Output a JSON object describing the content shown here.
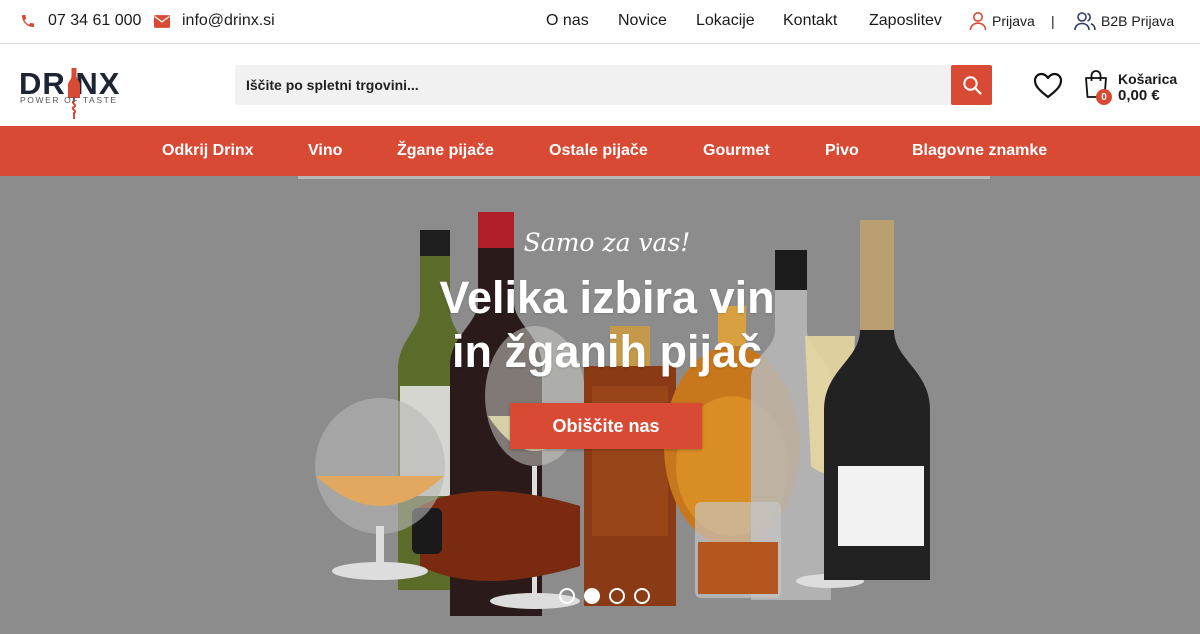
{
  "topbar": {
    "phone": "07 34 61 000",
    "email": "info@drinx.si",
    "nav": [
      "O nas",
      "Novice",
      "Lokacije",
      "Kontakt",
      "Zaposlitev"
    ],
    "login": "Prijava",
    "separator": "|",
    "b2b_login": "B2B Prijava"
  },
  "logo": {
    "text": "DR NX",
    "tagline": "POWER OF TASTE"
  },
  "search": {
    "placeholder": "Iščite po spletni trgovini..."
  },
  "cart": {
    "label": "Košarica",
    "total": "0,00 €",
    "count": "0"
  },
  "main_nav": [
    "Odkrij Drinx",
    "Vino",
    "Žgane pijače",
    "Ostale pijače",
    "Gourmet",
    "Pivo",
    "Blagovne znamke"
  ],
  "hero": {
    "tagline": "Samo za vas!",
    "headline_1": "Velika izbira vin",
    "headline_2": "in žganih pijač",
    "cta": "Obiščite nas",
    "slides": 4,
    "active_slide": 1
  },
  "colors": {
    "accent": "#d84a34",
    "hero_bg": "#8c8c8c",
    "text": "#1a1a1a"
  },
  "icons": [
    "phone-icon",
    "mail-icon",
    "user-icon",
    "b2b-users-icon",
    "search-icon",
    "heart-icon",
    "cart-bag-icon"
  ]
}
